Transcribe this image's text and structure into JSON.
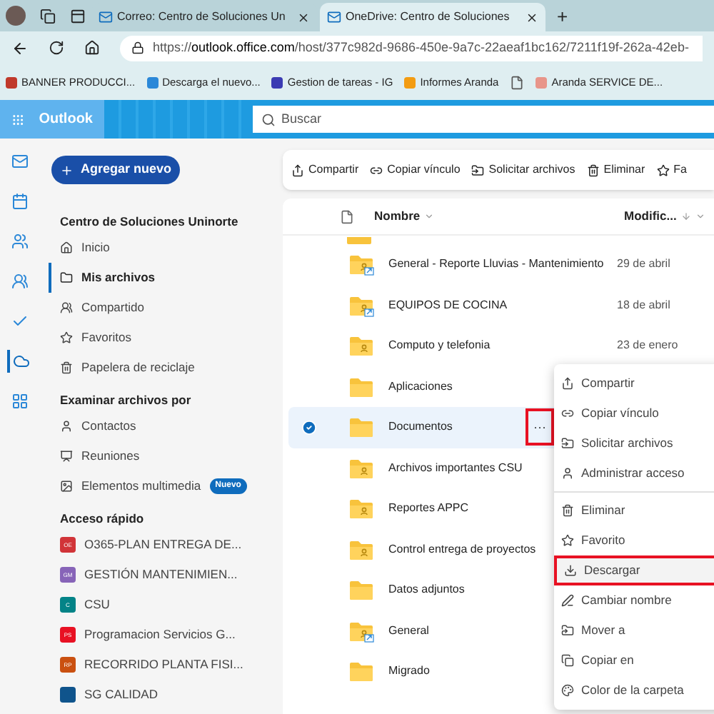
{
  "browser": {
    "tabs": [
      {
        "title": "Correo: Centro de Soluciones Un",
        "selected": false
      },
      {
        "title": "OneDrive: Centro de Soluciones",
        "selected": true
      }
    ],
    "new_tab": "+",
    "url_host": "outlook.office.com",
    "url_prefix": "https://",
    "url_path": "/host/377c982d-9686-450e-9a7c-22aeaf1bc162/7211f19f-262a-42eb-",
    "bookmarks": [
      {
        "label": "BANNER PRODUCCI...",
        "color": "#c0392b"
      },
      {
        "label": "Descarga el nuevo...",
        "color": "#2b88d8"
      },
      {
        "label": "Gestion de tareas - IG",
        "color": "#3b3bb3"
      },
      {
        "label": "Informes Aranda",
        "color": "#f39c12"
      },
      {
        "color": "#555555"
      },
      {
        "label": "Aranda SERVICE DE...",
        "color": "#e8958a"
      }
    ]
  },
  "app": {
    "name": "Outlook",
    "search": {
      "placeholder": "Buscar"
    }
  },
  "rail": [
    {
      "kind": "mail",
      "selected": false
    },
    {
      "kind": "calendar",
      "selected": false
    },
    {
      "kind": "people",
      "selected": false
    },
    {
      "kind": "teams",
      "selected": false
    },
    {
      "kind": "todo",
      "selected": false
    },
    {
      "kind": "onedrive",
      "selected": true
    },
    {
      "kind": "apps",
      "selected": false
    }
  ],
  "sidebar": {
    "add_button": "Agregar nuevo",
    "account": "Centro de Soluciones Uninorte",
    "items": [
      {
        "label": "Inicio",
        "kind": "home",
        "selected": false
      },
      {
        "label": "Mis archivos",
        "kind": "folder",
        "selected": true
      },
      {
        "label": "Compartido",
        "kind": "shared",
        "selected": false
      },
      {
        "label": "Favoritos",
        "kind": "star",
        "selected": false
      },
      {
        "label": "Papelera de reciclaje",
        "kind": "trash",
        "selected": false
      }
    ],
    "browse_heading": "Examinar archivos por",
    "browse": [
      {
        "label": "Contactos",
        "kind": "person"
      },
      {
        "label": "Reuniones",
        "kind": "meeting"
      },
      {
        "label": "Elementos multimedia",
        "kind": "media",
        "badge": "Nuevo"
      }
    ],
    "quick_heading": "Acceso rápido",
    "quick": [
      {
        "label": "O365-PLAN ENTREGA DE...",
        "initials": "OE",
        "color": "#d13438"
      },
      {
        "label": "GESTIÓN MANTENIMIEN...",
        "initials": "GM",
        "color": "#8764b8"
      },
      {
        "label": "CSU",
        "initials": "C",
        "color": "#038387"
      },
      {
        "label": "Programacion Servicios G...",
        "initials": "PS",
        "color": "#e81123"
      },
      {
        "label": "RECORRIDO PLANTA FISI...",
        "initials": "RP",
        "color": "#ca5010"
      },
      {
        "label": "SG CALIDAD",
        "color": "#0f548c"
      }
    ]
  },
  "toolbar": [
    {
      "label": "Compartir",
      "kind": "share"
    },
    {
      "label": "Copiar vínculo",
      "kind": "link"
    },
    {
      "label": "Solicitar archivos",
      "kind": "request"
    },
    {
      "label": "Eliminar",
      "kind": "delete"
    },
    {
      "label": "Fa",
      "kind": "star"
    }
  ],
  "table": {
    "columns": [
      "Nombre",
      "Modific..."
    ],
    "rows": [
      {
        "name": "General - Reporte Lluvias - Mantenimiento",
        "modified": "29 de abril",
        "kind": "shortcut",
        "selected": false
      },
      {
        "name": "EQUIPOS DE COCINA",
        "modified": "18 de abril",
        "kind": "shortcut",
        "selected": false
      },
      {
        "name": "Computo y telefonia",
        "modified": "23 de enero",
        "kind": "shared",
        "selected": false
      },
      {
        "name": "Aplicaciones",
        "modified": "",
        "kind": "plain",
        "selected": false
      },
      {
        "name": "Documentos",
        "modified": "",
        "kind": "plain",
        "selected": true,
        "more": "···"
      },
      {
        "name": "Archivos importantes CSU",
        "modified": "",
        "kind": "shared",
        "selected": false
      },
      {
        "name": "Reportes APPC",
        "modified": "",
        "kind": "shared",
        "selected": false
      },
      {
        "name": "Control entrega de proyectos",
        "modified": "",
        "kind": "shared",
        "selected": false
      },
      {
        "name": "Datos adjuntos",
        "modified": "",
        "kind": "plain",
        "selected": false
      },
      {
        "name": "General",
        "modified": "",
        "kind": "shortcut",
        "selected": false
      },
      {
        "name": "Migrado",
        "modified": "",
        "kind": "plain",
        "selected": false
      }
    ]
  },
  "context_menu": [
    {
      "label": "Compartir",
      "kind": "share",
      "highlighted": false
    },
    {
      "label": "Copiar vínculo",
      "kind": "link",
      "highlighted": false
    },
    {
      "label": "Solicitar archivos",
      "kind": "request",
      "highlighted": false
    },
    {
      "label": "Administrar acceso",
      "kind": "person",
      "highlighted": false,
      "divider_after": true
    },
    {
      "label": "Eliminar",
      "kind": "delete",
      "highlighted": false
    },
    {
      "label": "Favorito",
      "kind": "star",
      "highlighted": false
    },
    {
      "label": "Descargar",
      "kind": "download",
      "highlighted": true
    },
    {
      "label": "Cambiar nombre",
      "kind": "rename",
      "highlighted": false
    },
    {
      "label": "Mover a",
      "kind": "move",
      "highlighted": false
    },
    {
      "label": "Copiar en",
      "kind": "copy",
      "highlighted": false
    },
    {
      "label": "Color de la carpeta",
      "kind": "palette",
      "highlighted": false
    }
  ]
}
